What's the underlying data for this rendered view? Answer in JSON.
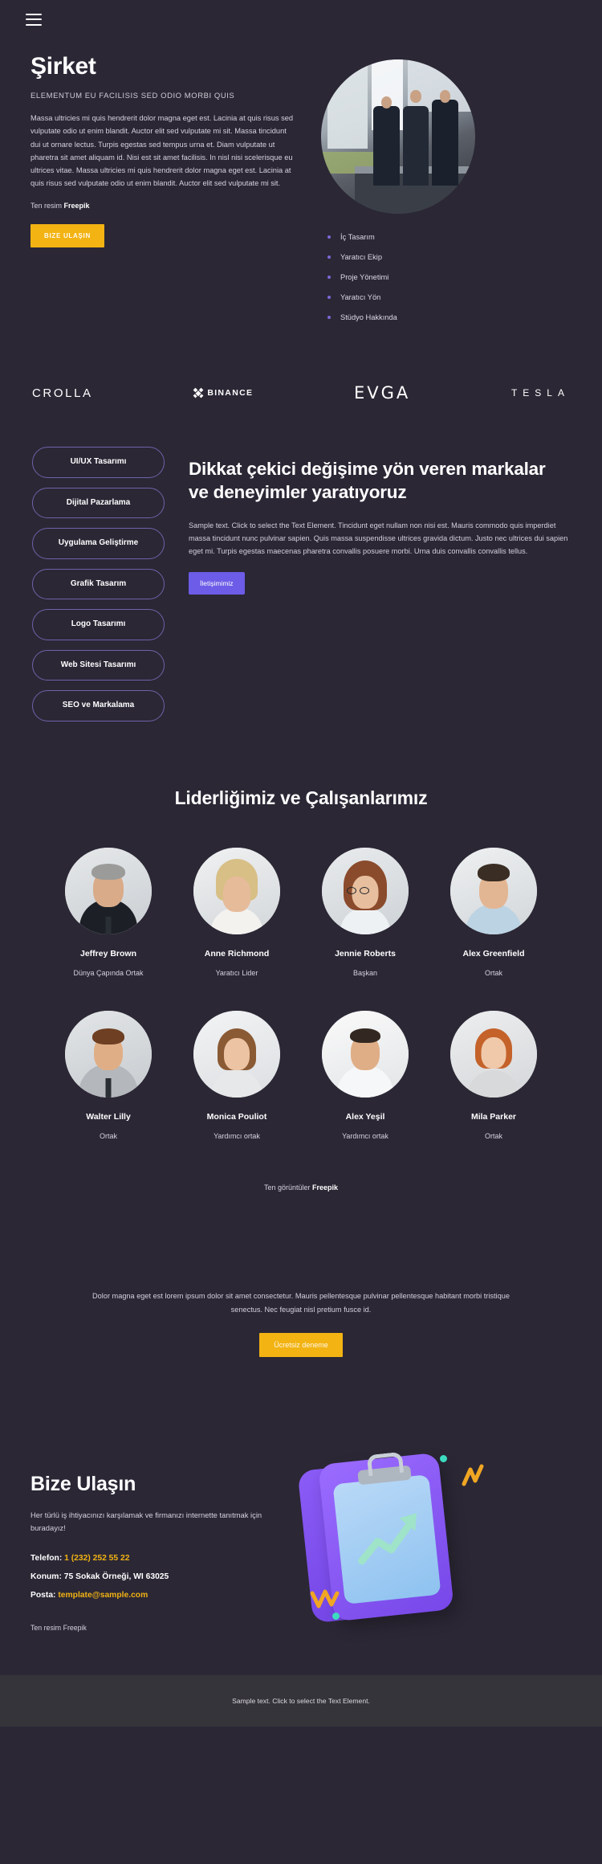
{
  "nav": {
    "menu_icon": "hamburger-menu-icon"
  },
  "hero": {
    "title": "Şirket",
    "subtitle": "ELEMENTUM EU FACILISIS SED ODIO MORBI QUIS",
    "body": "Massa ultricies mi quis hendrerit dolor magna eget est. Lacinia at quis risus sed vulputate odio ut enim blandit. Auctor elit sed vulputate mi sit. Massa tincidunt dui ut ornare lectus. Turpis egestas sed tempus urna et. Diam vulputate ut pharetra sit amet aliquam id. Nisi est sit amet facilisis. In nisl nisi scelerisque eu ultrices vitae. Massa ultricies mi quis hendrerit dolor magna eget est. Lacinia at quis risus sed vulputate odio ut enim blandit. Auctor elit sed vulputate mi sit.",
    "credit_prefix": "Ten resim ",
    "credit_brand": "Freepik",
    "cta_label": "BIZE ULAŞIN",
    "list": [
      {
        "label": "İç Tasarım"
      },
      {
        "label": "Yaratıcı Ekip"
      },
      {
        "label": "Proje Yönetimi"
      },
      {
        "label": "Yaratıcı Yön"
      },
      {
        "label": "Stüdyo Hakkında"
      }
    ]
  },
  "logos": [
    {
      "name": "CROLLA"
    },
    {
      "name": "BINANCE"
    },
    {
      "name": "EVGA"
    },
    {
      "name": "TESLA"
    }
  ],
  "services": {
    "pills": [
      {
        "label": "UI/UX Tasarımı"
      },
      {
        "label": "Dijital Pazarlama"
      },
      {
        "label": "Uygulama Geliştirme"
      },
      {
        "label": "Grafik Tasarım"
      },
      {
        "label": "Logo Tasarımı"
      },
      {
        "label": "Web Sitesi Tasarımı"
      },
      {
        "label": "SEO ve Markalama"
      }
    ],
    "heading": "Dikkat çekici değişime yön veren markalar ve deneyimler yaratıyoruz",
    "body": "Sample text. Click to select the Text Element. Tincidunt eget nullam non nisi est. Mauris commodo quis imperdiet massa tincidunt nunc pulvinar sapien. Quis massa suspendisse ultrices gravida dictum. Justo nec ultrices dui sapien eget mi. Turpis egestas maecenas pharetra convallis posuere morbi. Urna duis convallis convallis tellus.",
    "cta_label": "İletişimimiz"
  },
  "team": {
    "title": "Liderliğimiz ve Çalışanlarımız",
    "members": [
      {
        "name": "Jeffrey Brown",
        "role": "Dünya Çapında Ortak"
      },
      {
        "name": "Anne Richmond",
        "role": "Yaratıcı Lider"
      },
      {
        "name": "Jennie Roberts",
        "role": "Başkan"
      },
      {
        "name": "Alex Greenfield",
        "role": "Ortak"
      },
      {
        "name": "Walter Lilly",
        "role": "Ortak"
      },
      {
        "name": "Monica Pouliot",
        "role": "Yardımcı ortak"
      },
      {
        "name": "Alex Yeşil",
        "role": "Yardımcı ortak"
      },
      {
        "name": "Mila Parker",
        "role": "Ortak"
      }
    ],
    "credit_prefix": "Ten görüntüler ",
    "credit_brand": "Freepik"
  },
  "cta": {
    "text": "Dolor magna eget est lorem ipsum dolor sit amet consectetur. Mauris pellentesque pulvinar pellentesque habitant morbi tristique senectus. Nec feugiat nisl pretium fusce id.",
    "button_label": "Ücretsiz deneme"
  },
  "contact": {
    "title": "Bize Ulaşın",
    "intro": "Her türlü iş ihtiyacınızı karşılamak ve firmanızı internette tanıtmak için buradayız!",
    "phone_label": "Telefon: ",
    "phone_value": "1 (232) 252 55 22",
    "location_label": "Konum: ",
    "location_value": "75 Sokak Örneği, WI 63025",
    "email_label": "Posta: ",
    "email_value": "template@sample.com",
    "credit": "Ten resim Freepik",
    "illustration": "clipboard-chart-illustration"
  },
  "footer": {
    "text": "Sample text. Click to select the Text Element."
  },
  "colors": {
    "background": "#2b2735",
    "accent_yellow": "#f2b313",
    "accent_purple": "#6c5ce7",
    "pill_border": "#6f63a8",
    "footer_bg": "#35343a"
  }
}
